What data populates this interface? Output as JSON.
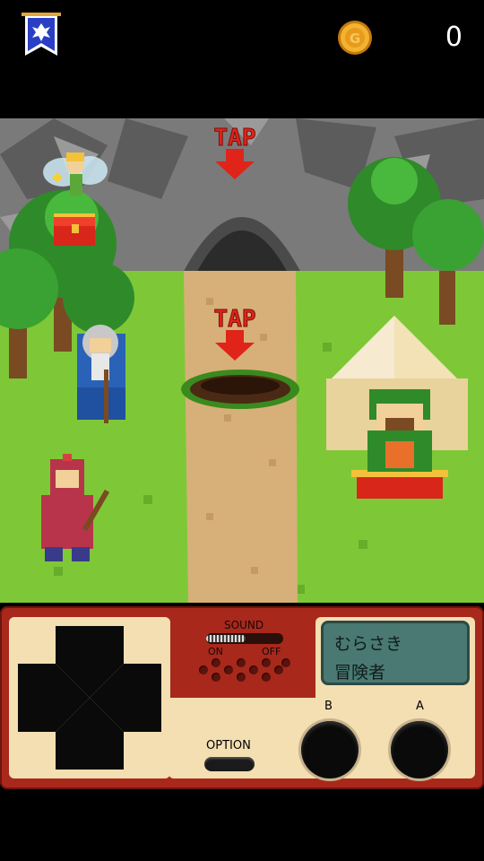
{
  "header": {
    "coin_count": "0",
    "banner_icon": "guild-banner-icon",
    "coin_icon": "gold-coin-icon"
  },
  "scene": {
    "tap_top": "TAP",
    "tap_middle": "TAP",
    "characters": [
      "fairy",
      "wizard",
      "knight",
      "merchant"
    ]
  },
  "controller": {
    "sound_label": "SOUND",
    "sound_on": "ON",
    "sound_off": "OFF",
    "lcd_line1": "むらさき",
    "lcd_line2": "冒険者",
    "option_label": "OPTION",
    "b_label": "B",
    "a_label": "A"
  },
  "colors": {
    "sky_rock": "#6e6e6e",
    "grass": "#7ec838",
    "path": "#d7b079",
    "controller_body": "#a8281c",
    "controller_panel": "#f3dfb2",
    "lcd": "#4a7872",
    "tap_arrow": "#e0241a"
  }
}
